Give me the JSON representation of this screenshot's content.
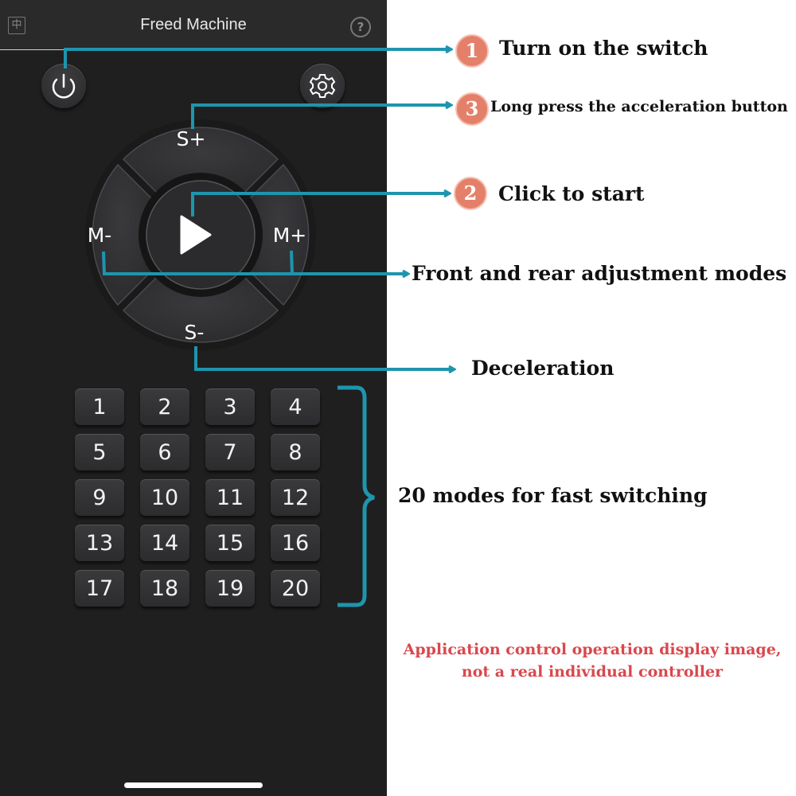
{
  "app": {
    "title": "Freed Machine",
    "lang_icon_glyph": "中",
    "help_icon_glyph": "?"
  },
  "controls": {
    "power": "power-icon",
    "settings": "gear-icon",
    "speed_up": "S+",
    "speed_down": "S-",
    "mode_down": "M-",
    "mode_up": "M+",
    "play": "play-icon"
  },
  "mode_buttons": [
    "1",
    "2",
    "3",
    "4",
    "5",
    "6",
    "7",
    "8",
    "9",
    "10",
    "11",
    "12",
    "13",
    "14",
    "15",
    "16",
    "17",
    "18",
    "19",
    "20"
  ],
  "callouts": {
    "step1": {
      "badge": "1",
      "text": "Turn on the switch"
    },
    "step3": {
      "badge": "3",
      "text": "Long press the acceleration button"
    },
    "step2": {
      "badge": "2",
      "text": "Click to start"
    },
    "front_rear": "Front and rear adjustment modes",
    "deceleration": "Deceleration",
    "modes": "20 modes for fast switching"
  },
  "disclaimer": {
    "line1": "Application control operation display image,",
    "line2": "not a real individual controller"
  },
  "colors": {
    "accent_line": "#1e95ad",
    "badge": "#e4806a",
    "disclaimer": "#d9484d",
    "panel_bg": "#1f1f1f"
  }
}
